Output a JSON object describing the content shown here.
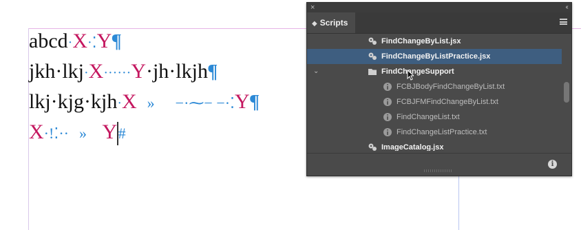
{
  "document": {
    "lines": [
      {
        "a": "abcd",
        "b": "·",
        "x": "X",
        "c": "·",
        "d": "⁚",
        "y": "Y",
        "e": "¶"
      },
      {
        "a": "jkh·lkj",
        "b": "·",
        "x": "X",
        "c": "······",
        "y": "Y",
        "d": "·jh·lkjh",
        "e": "¶"
      },
      {
        "a": "lkj·kjg·kjh",
        "b": "·",
        "x": "X",
        "c": "»",
        "d": "−·⁓−  −·⁚",
        "y": "Y",
        "e": "¶"
      },
      {
        "x": "X",
        "c": "·!⁚··",
        "d": "»",
        "y": "Y",
        "e": "#"
      }
    ]
  },
  "panel": {
    "close": "×",
    "collapse": "‹‹",
    "tab_arrows": "◆",
    "tab_label": "Scripts",
    "items": [
      {
        "label": "FindChangeByList.jsx"
      },
      {
        "label": "FindChangeByListPractice.jsx"
      },
      {
        "label": "FindChangeSupport"
      },
      {
        "label": "FCBJBodyFindChangeByList.txt"
      },
      {
        "label": "FCBJFMFindChangeByList.txt"
      },
      {
        "label": "FindChangeList.txt"
      },
      {
        "label": "FindChangeListPractice.txt"
      },
      {
        "label": "ImageCatalog.jsx"
      }
    ],
    "info_label": "i",
    "chevron": "⌄"
  },
  "colors": {
    "accent_text": "#c4175f",
    "hidden_char": "#2c89d6",
    "panel_bg": "#4a4a4a",
    "selected_row": "#3e5e80"
  }
}
